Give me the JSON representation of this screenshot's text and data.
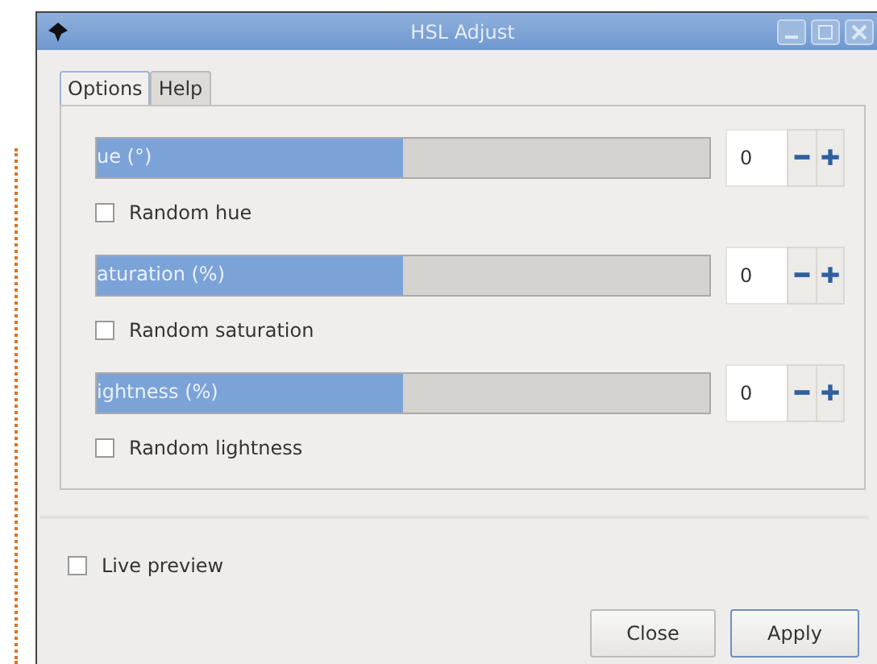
{
  "window": {
    "title": "HSL Adjust"
  },
  "tabs": [
    {
      "label": "Options",
      "selected": true
    },
    {
      "label": "Help",
      "selected": false
    }
  ],
  "sliders": [
    {
      "label": "ue (°)",
      "level": 0.5,
      "value": "0",
      "random": {
        "label": "Random hue",
        "checked": false
      }
    },
    {
      "label": "aturation (%)",
      "level": 0.5,
      "value": "0",
      "random": {
        "label": "Random saturation",
        "checked": false
      }
    },
    {
      "label": "ightness (%)",
      "level": 0.5,
      "value": "0",
      "random": {
        "label": "Random lightness",
        "checked": false
      }
    }
  ],
  "live_preview": {
    "label": "Live preview",
    "checked": false
  },
  "buttons": [
    {
      "label": "Close",
      "default": false
    },
    {
      "label": "Apply",
      "default": true
    }
  ]
}
